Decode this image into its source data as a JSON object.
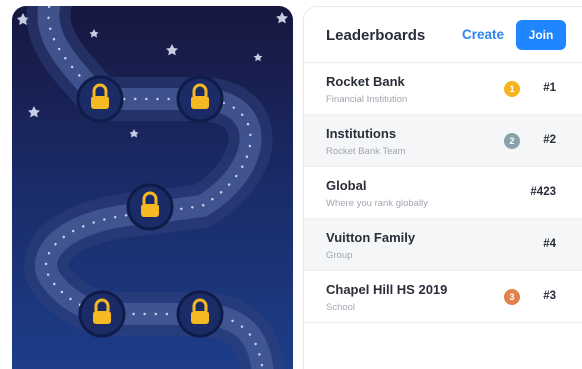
{
  "header": {
    "title": "Leaderboards",
    "create_label": "Create",
    "join_label": "Join"
  },
  "leaderboards": [
    {
      "name": "Rocket Bank",
      "subtitle": "Financial Institution",
      "medal": "1",
      "medal_color": "#f6b31b",
      "rank": "#1"
    },
    {
      "name": "Institutions",
      "subtitle": "Rocket Bank Team",
      "medal": "2",
      "medal_color": "#8aa1ab",
      "rank": "#2"
    },
    {
      "name": "Global",
      "subtitle": "Where you rank globally",
      "medal": "",
      "medal_color": "",
      "rank": "#423"
    },
    {
      "name": "Vuitton Family",
      "subtitle": "Group",
      "medal": "",
      "medal_color": "",
      "rank": "#4"
    },
    {
      "name": "Chapel Hill HS 2019",
      "subtitle": "School",
      "medal": "3",
      "medal_color": "#e0824c",
      "rank": "#3"
    }
  ],
  "map": {
    "node_icon": "lock-icon",
    "locked_levels": 5,
    "colors": {
      "sky_top": "#17173f",
      "sky_bottom": "#1d3f8c",
      "path": "#4a5d9a",
      "node": "#1b2b66",
      "lock": "#f5b921"
    }
  },
  "colors": {
    "accent": "#1f86ff",
    "text": "#2b2e3a",
    "muted": "#a3a6b0"
  }
}
